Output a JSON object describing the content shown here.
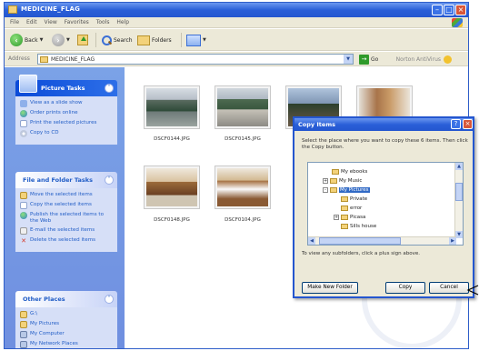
{
  "window": {
    "title": "MEDICINE_FLAG",
    "accent": "#2456cf"
  },
  "menu": [
    "File",
    "Edit",
    "View",
    "Favorites",
    "Tools",
    "Help"
  ],
  "toolbar": {
    "back_label": "Back",
    "search_label": "Search",
    "folders_label": "Folders"
  },
  "address": {
    "label": "Address",
    "value": "MEDICINE_FLAG",
    "go_label": "Go",
    "norton_label": "Norton AntiVirus"
  },
  "left_pane": {
    "picture_tasks": {
      "title": "Picture Tasks",
      "items": [
        {
          "label": "View as a slide show",
          "icon": "slideshow-icon"
        },
        {
          "label": "Order prints online",
          "icon": "globe-icon"
        },
        {
          "label": "Print the selected pictures",
          "icon": "print-icon"
        },
        {
          "label": "Copy to CD",
          "icon": "cd-icon"
        }
      ]
    },
    "file_folder_tasks": {
      "title": "File and Folder Tasks",
      "items": [
        {
          "label": "Move the selected items",
          "icon": "move-icon"
        },
        {
          "label": "Copy the selected items",
          "icon": "copy-icon"
        },
        {
          "label": "Publish the selected items to the Web",
          "icon": "web-icon"
        },
        {
          "label": "E-mail the selected items",
          "icon": "email-icon"
        },
        {
          "label": "Delete the selected items",
          "icon": "delete-icon"
        }
      ]
    },
    "other_places": {
      "title": "Other Places",
      "items": [
        {
          "label": "G:\\",
          "icon": "folder-icon"
        },
        {
          "label": "My Pictures",
          "icon": "folder-icon"
        },
        {
          "label": "My Computer",
          "icon": "computer-icon"
        },
        {
          "label": "My Network Places",
          "icon": "network-icon"
        }
      ]
    }
  },
  "files": [
    {
      "name": "DSCF0144.JPG"
    },
    {
      "name": "DSCF0145.JPG"
    },
    {
      "name": ""
    },
    {
      "name": ""
    },
    {
      "name": "DSCF0148.JPG"
    },
    {
      "name": "DSCF0104.JPG"
    }
  ],
  "dialog": {
    "title": "Copy Items",
    "instructions": "Select the place where you want to copy these 6 items. Then click the Copy button.",
    "tree": [
      {
        "label": "My ebooks",
        "expander": "",
        "selected": false
      },
      {
        "label": "My Music",
        "expander": "+",
        "selected": false
      },
      {
        "label": "My Pictures",
        "expander": "-",
        "selected": true
      },
      {
        "label": "Private",
        "expander": "",
        "selected": false
      },
      {
        "label": "error",
        "expander": "",
        "selected": false
      },
      {
        "label": "Picasa",
        "expander": "+",
        "selected": false
      },
      {
        "label": "Sills house",
        "expander": "",
        "selected": false
      }
    ],
    "hint": "To view any subfolders, click a plus sign above.",
    "buttons": {
      "new_folder": "Make New Folder",
      "copy": "Copy",
      "cancel": "Cancel"
    }
  }
}
